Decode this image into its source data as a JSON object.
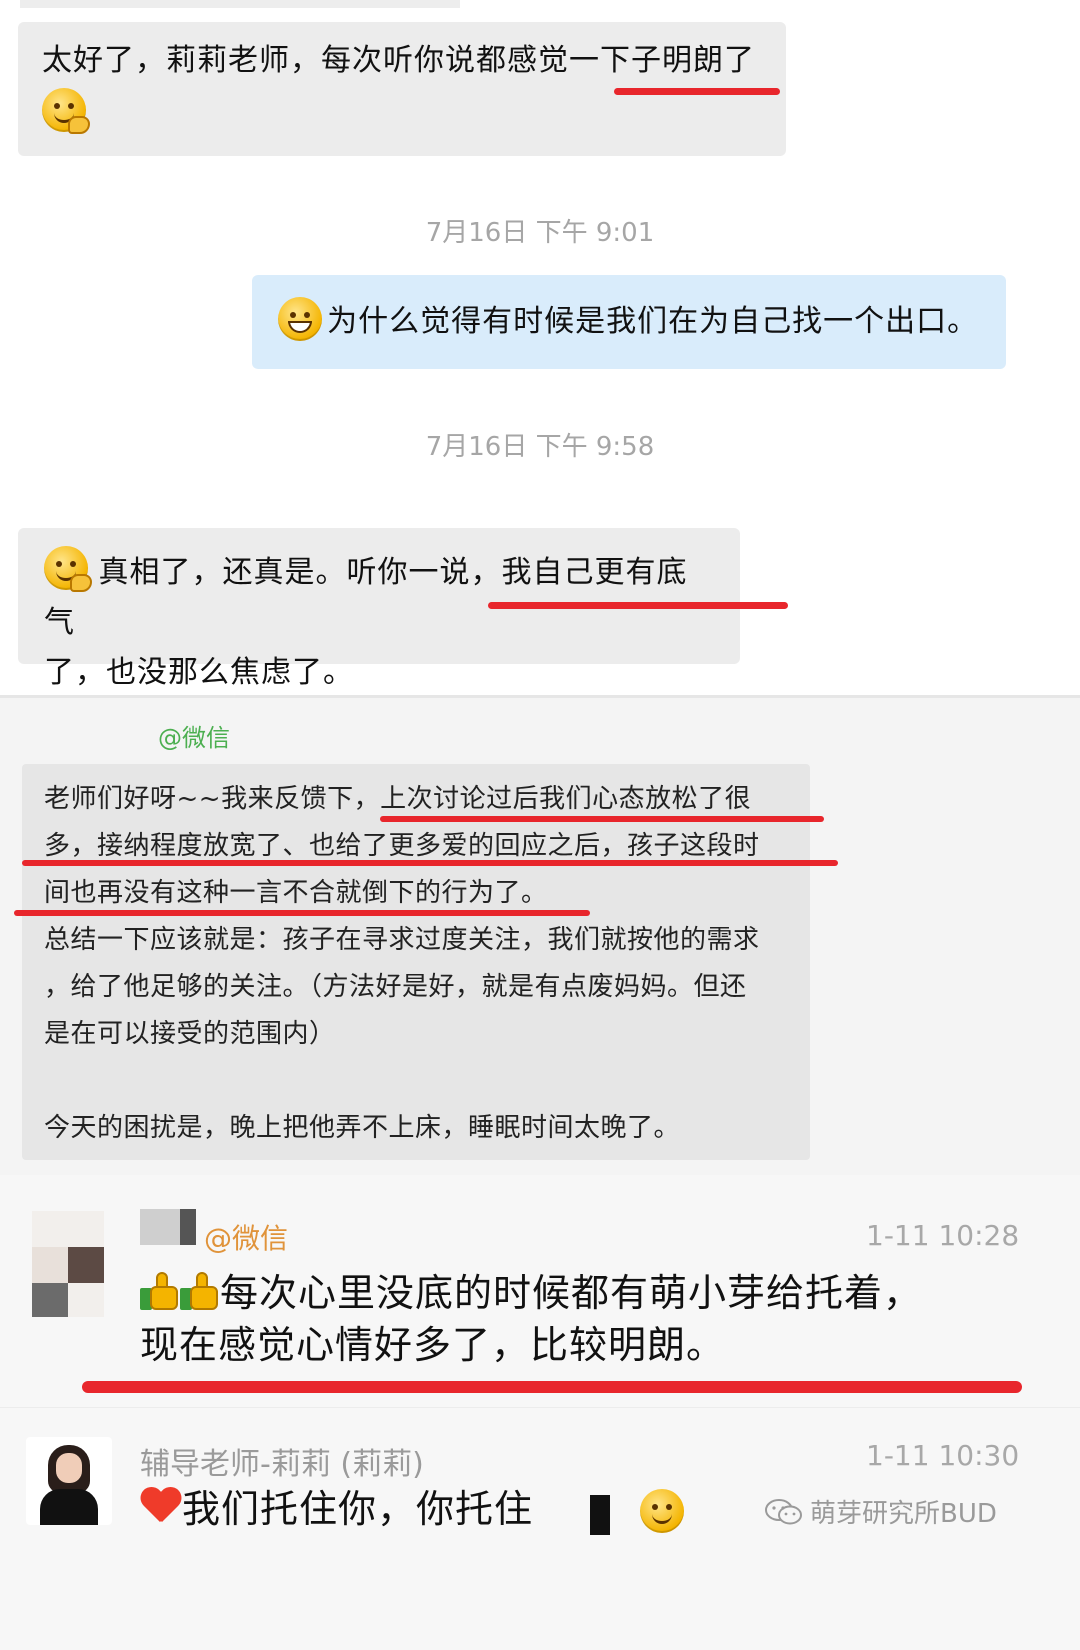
{
  "chat1": {
    "msg1": {
      "text_line1": "太好了，莉莉老师，每次听你说都感觉一下子明朗了",
      "emoji": "thinking-face"
    },
    "timestamp1": "7月16日 下午 9:01",
    "msg2": {
      "emoji": "grin-face",
      "text": "为什么觉得有时候是我们在为自己找一个出口。"
    },
    "timestamp2": "7月16日 下午 9:58",
    "msg3": {
      "emoji": "thinking-face",
      "text_line1": "真相了，还真是。听你一说，我自己更有底气",
      "text_line2": "了，也没那么焦虑了。"
    }
  },
  "chat2": {
    "sender_tag": "@微信",
    "lines": [
      "老师们好呀~~我来反馈下，上次讨论过后我们心态放松了很",
      "多，接纳程度放宽了、也给了更多爱的回应之后，孩子这段时",
      "间也再没有这种一言不合就倒下的行为了。",
      "总结一下应该就是：孩子在寻求过度关注，我们就按他的需求",
      "，给了他足够的关注。（方法好是好，就是有点废妈妈。但还",
      "是在可以接受的范围内）",
      "",
      "今天的困扰是，晚上把他弄不上床，睡眠时间太晚了。"
    ]
  },
  "chat3": {
    "post1": {
      "sender_tag": "@微信",
      "time": "1-11 10:28",
      "emoji": "thumbs-up",
      "line1": "每次心里没底的时候都有萌小芽给托着，",
      "line2": "现在感觉心情好多了，比较明朗。"
    },
    "post2": {
      "sender": "辅导老师-莉莉 (莉莉)",
      "time": "1-11 10:30",
      "emoji": "red-heart",
      "text": "我们托住你，你托住",
      "end_emoji": "smiling-face"
    },
    "watermark": "萌芽研究所BUD"
  },
  "colors": {
    "underline": "#e8262c",
    "bubble_gray": "#ececec",
    "bubble_blue": "#d9ecfb",
    "wechat_green": "#4caf50",
    "tag_orange": "#e0933a"
  }
}
